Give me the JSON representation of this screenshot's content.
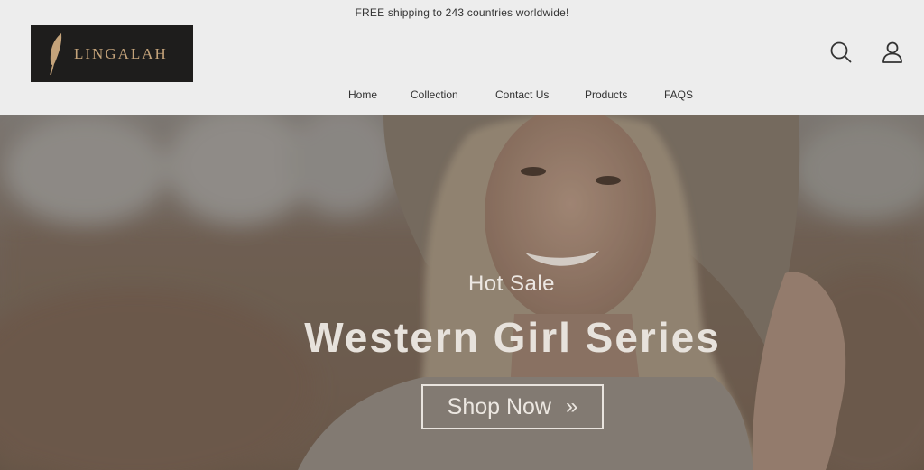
{
  "announcement": {
    "text": "FREE shipping to 243 countries worldwide!"
  },
  "header": {
    "brand": "LINGALAH",
    "icons": {
      "feather": "feather-icon",
      "search": "search-icon",
      "account": "account-icon"
    },
    "nav": [
      {
        "label": "Home"
      },
      {
        "label": "Collection"
      },
      {
        "label": "Contact Us"
      },
      {
        "label": "Products"
      },
      {
        "label": "FAQS"
      }
    ]
  },
  "hero": {
    "eyebrow": "Hot Sale",
    "title": "Western Girl Series",
    "cta_label": "Shop Now",
    "cta_chevron": "»"
  },
  "colors": {
    "logo_bg": "#1e1d1c",
    "logo_gold": "#c4a37a",
    "header_bg": "#ededed"
  }
}
